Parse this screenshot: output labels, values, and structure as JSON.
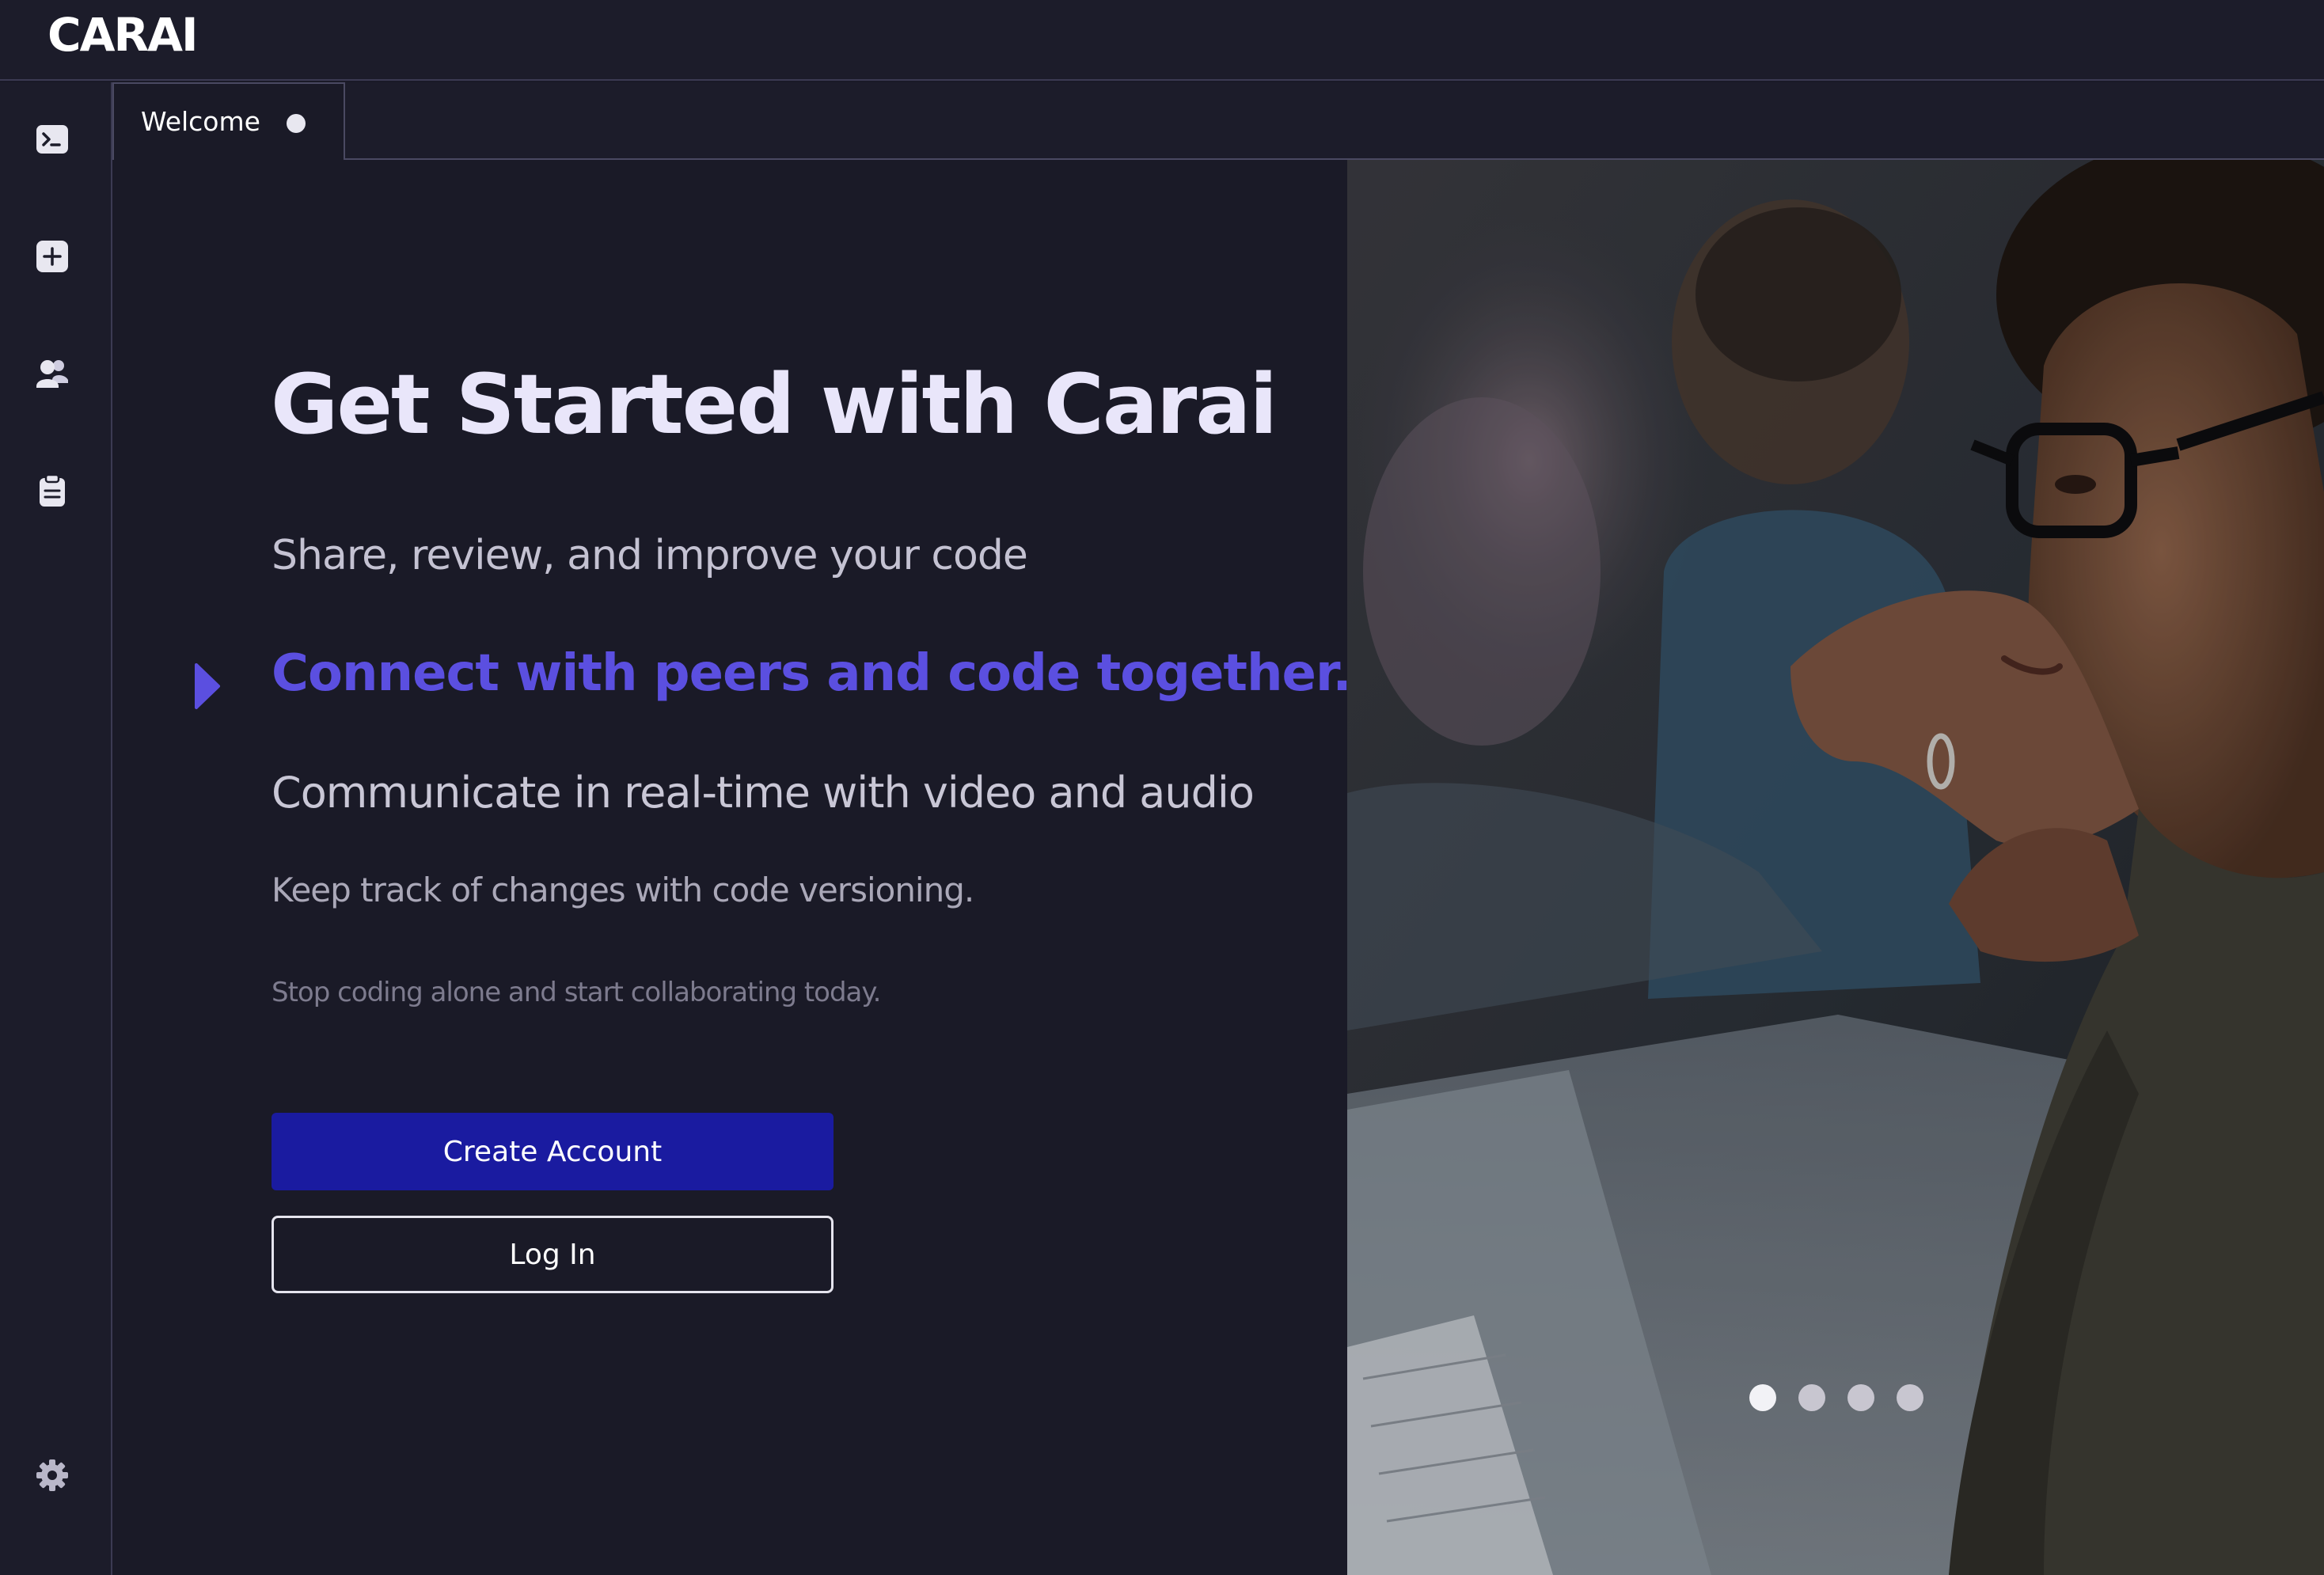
{
  "app": {
    "logo": "CARAI"
  },
  "sidebar": {
    "items": [
      {
        "name": "terminal-icon"
      },
      {
        "name": "plus-square-icon"
      },
      {
        "name": "users-icon"
      },
      {
        "name": "clipboard-icon"
      }
    ],
    "bottom": {
      "name": "gear-icon"
    }
  },
  "tabs": [
    {
      "label": "Welcome",
      "unsaved": true
    }
  ],
  "welcome": {
    "headline": "Get Started with Carai",
    "features": [
      "Share, review, and improve your code",
      "Connect with peers and code together.",
      "Communicate in real-time with video and audio",
      "Keep track of changes with code versioning.",
      "Stop coding alone and start collaborating today."
    ],
    "active_feature_index": 1,
    "create_account_label": "Create Account",
    "login_label": "Log In"
  },
  "carousel": {
    "slides": 4,
    "active": 0
  },
  "colors": {
    "accent": "#5b4fe0",
    "primary_button": "#1a1ba0",
    "background": "#1a1a27"
  }
}
